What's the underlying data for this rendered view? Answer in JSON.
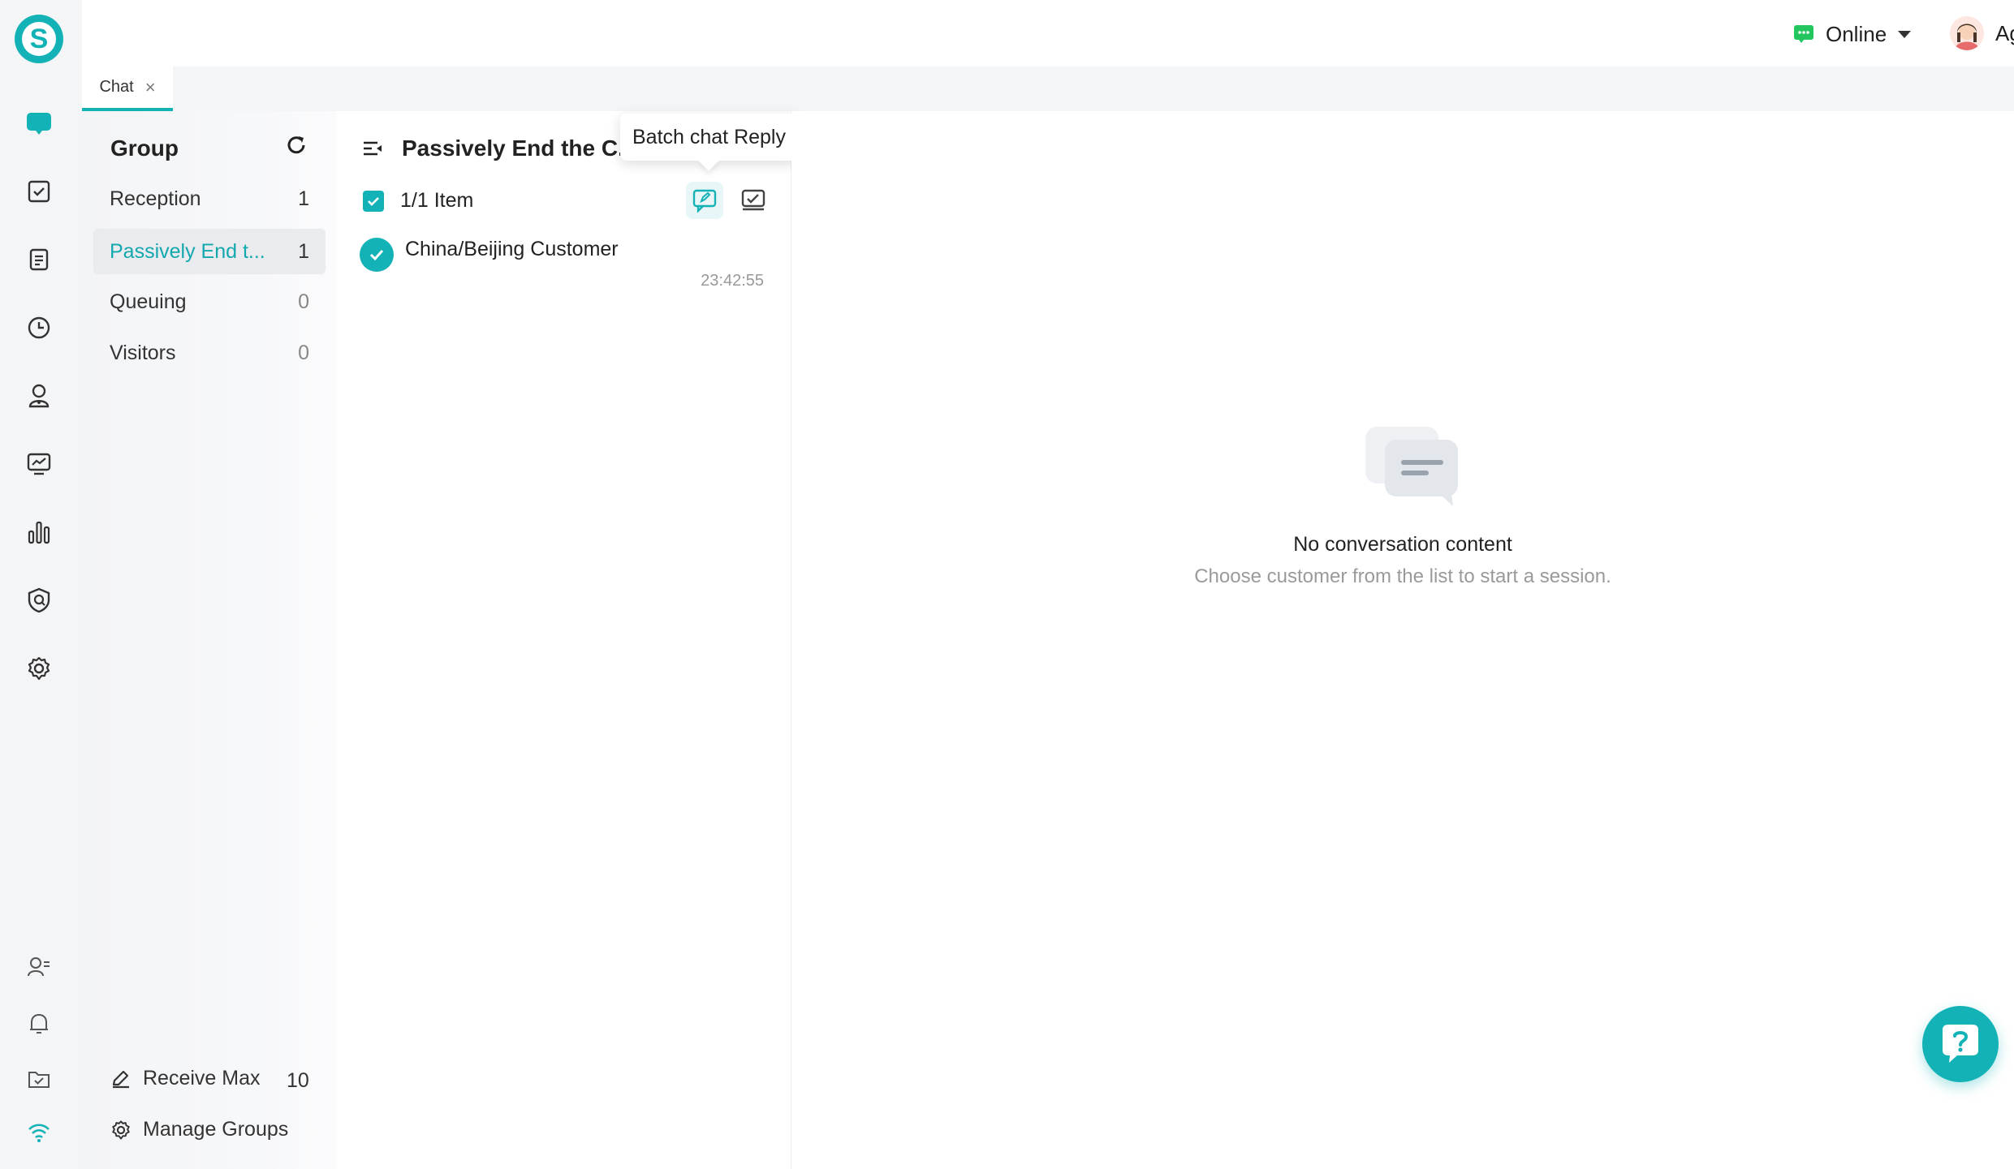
{
  "header": {
    "status_label": "Online",
    "agent_label": "Agent",
    "status_color": "#22c55e"
  },
  "tabs": [
    {
      "label": "Chat",
      "close": "×"
    }
  ],
  "rail": {
    "icons": [
      "chat-icon",
      "task-icon",
      "document-icon",
      "history-icon",
      "customer-icon",
      "monitor-icon",
      "stats-icon",
      "security-icon",
      "settings-icon",
      "contact-icon",
      "bell-icon",
      "folder-check-icon",
      "wifi-icon"
    ]
  },
  "groups": {
    "title": "Group",
    "items": [
      {
        "label": "Reception",
        "count": "1"
      },
      {
        "label": "Passively End t...",
        "count": "1"
      },
      {
        "label": "Queuing",
        "count": "0"
      },
      {
        "label": "Visitors",
        "count": "0"
      }
    ],
    "receive_max_label": "Receive Max",
    "receive_max_value": "10",
    "manage_groups_label": "Manage Groups"
  },
  "chat_list": {
    "title": "Passively End the C...",
    "selection_label": "1/1 Item",
    "tooltip": "Batch chat Reply",
    "items": [
      {
        "name": "China/Beijing Customer",
        "time": "23:42:55"
      }
    ]
  },
  "conversation": {
    "empty_title": "No conversation content",
    "empty_subtitle": "Choose customer from the list to start a session."
  },
  "colors": {
    "accent": "#13b2b6",
    "rail_bg": "#f4f5f7"
  }
}
